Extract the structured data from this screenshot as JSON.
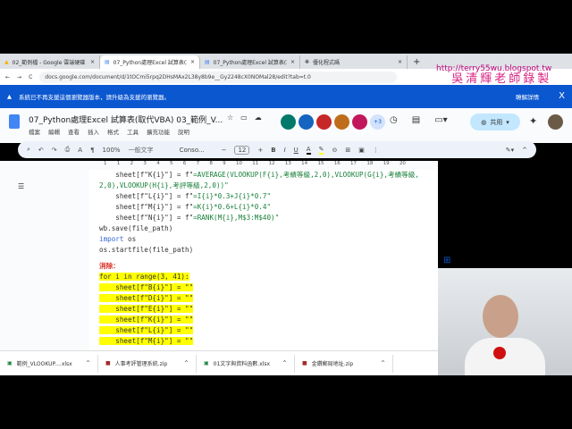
{
  "tabs": [
    {
      "title": "02_範例檔 - Google 雲端硬碟"
    },
    {
      "title": "07_Python處理Excel 試算表(取代"
    },
    {
      "title": "07_Python處理Excel 試算表(取代"
    },
    {
      "title": "優化程式碼"
    }
  ],
  "address": {
    "url": "docs.google.com/document/d/1tOCmi5rpq2DHsMAx2L38y8b9e__Gy2248cX0NOMal28/edit?tab=t.0"
  },
  "watermark": {
    "url": "http://terry55wu.blogspot.tw",
    "text": "吳清輝老師錄製"
  },
  "banner": {
    "message": "系統已不再支援這個瀏覽器版本，請升級為支援的瀏覽器。",
    "link": "瞭解詳情",
    "close": "X"
  },
  "doc": {
    "title": "07_Python處理Excel 試算表(取代VBA) 03_範例_V...",
    "menu": [
      "檔案",
      "編輯",
      "查看",
      "插入",
      "格式",
      "工具",
      "擴充功能",
      "說明"
    ],
    "collab_more": "+3",
    "share": "共用"
  },
  "toolbar": {
    "zoom": "100%",
    "style": "一般文字",
    "font": "Conso...",
    "size": "12",
    "bold": "B",
    "italic": "I",
    "underline": "U",
    "text_color": "A"
  },
  "ruler": [
    "1",
    "1",
    "2",
    "3",
    "4",
    "5",
    "6",
    "7",
    "8",
    "9",
    "10",
    "11",
    "12",
    "13",
    "14",
    "15",
    "16",
    "17",
    "18",
    "19",
    "20"
  ],
  "code": {
    "l1a": "    sheet[f\"K{i}\"] = f\"",
    "l1b": "=AVERAGE(VLOOKUP(F{i},考績等級,2,0),VLOOKUP(G{i},考績等級,",
    "l2": "2,0),VLOOKUP(H{i},考評等級,2,0))\"",
    "l3a": "    sheet[f\"L{i}\"] = f\"",
    "l3b": "=I{i}*0.3+J{i}*0.7\"",
    "l4a": "    sheet[f\"M{i}\"] = f\"",
    "l4b": "=K{i}*0.6+L{i}*0.4\"",
    "l5a": "    sheet[f\"N{i}\"] = f\"",
    "l5b": "=RANK(M{i},M$3:M$40)\"",
    "l6": "wb.save(file_path)",
    "l7k": "import",
    "l7": " os",
    "l8": "os.startfile(file_path)",
    "heading": "消除：",
    "for": "for i in range(3, 41):",
    "clear": [
      "    sheet[f\"B{i}\"] = \"\"",
      "    sheet[f\"D{i}\"] = \"\"",
      "    sheet[f\"E{i}\"] = \"\"",
      "    sheet[f\"K{i}\"] = \"\"",
      "    sheet[f\"L{i}\"] = \"\"",
      "    sheet[f\"M{i}\"] = \"\""
    ]
  },
  "downloads": [
    {
      "name": "範例_VLOOKUP....xlsx"
    },
    {
      "name": "人事考評管理系統.zip"
    },
    {
      "name": "01文字與資料函數.xlsx"
    },
    {
      "name": "金鑽郵局地址.zip"
    }
  ]
}
